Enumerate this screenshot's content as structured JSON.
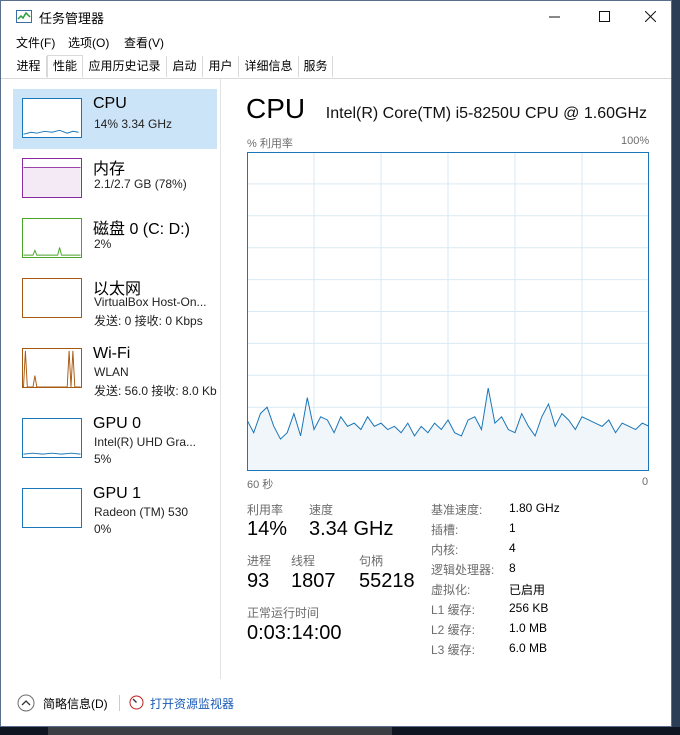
{
  "window": {
    "title": "任务管理器"
  },
  "menu": [
    "文件(F)",
    "选项(O)",
    "查看(V)"
  ],
  "tabs": [
    "进程",
    "性能",
    "应用历史记录",
    "启动",
    "用户",
    "详细信息",
    "服务"
  ],
  "active_tab": "性能",
  "resources": [
    {
      "name": "CPU",
      "line1": "14% 3.34 GHz",
      "line2": "",
      "color": "#1a76b8"
    },
    {
      "name": "内存",
      "line1": "2.1/2.7 GB (78%)",
      "line2": "",
      "color": "#8b2a9e"
    },
    {
      "name": "磁盘 0 (C: D:)",
      "line1": "2%",
      "line2": "",
      "color": "#4aa42a"
    },
    {
      "name": "以太网",
      "line1": "VirtualBox Host-On...",
      "line2": "发送: 0 接收: 0 Kbps",
      "color": "#a75a12"
    },
    {
      "name": "Wi-Fi",
      "line1": "WLAN",
      "line2": "发送: 56.0 接收: 8.0 Kb",
      "color": "#a75a12"
    },
    {
      "name": "GPU 0",
      "line1": "Intel(R) UHD Gra...",
      "line2": "5%",
      "color": "#1a76b8"
    },
    {
      "name": "GPU 1",
      "line1": "Radeon (TM) 530",
      "line2": "0%",
      "color": "#1a76b8"
    }
  ],
  "main": {
    "title": "CPU",
    "model": "Intel(R) Core(TM) i5-8250U CPU @ 1.60GHz",
    "y_label": "% 利用率",
    "y_max_label": "100%",
    "x_left_label": "60 秒",
    "x_right_label": "0"
  },
  "chart_data": {
    "type": "area",
    "ylim": [
      0,
      100
    ],
    "x": [
      60,
      59,
      58,
      57,
      56,
      55,
      54,
      53,
      52,
      51,
      50,
      49,
      48,
      47,
      46,
      45,
      44,
      43,
      42,
      41,
      40,
      39,
      38,
      37,
      36,
      35,
      34,
      33,
      32,
      31,
      30,
      29,
      28,
      27,
      26,
      25,
      24,
      23,
      22,
      21,
      20,
      19,
      18,
      17,
      16,
      15,
      14,
      13,
      12,
      11,
      10,
      9,
      8,
      7,
      6,
      5,
      4,
      3,
      2,
      1,
      0
    ],
    "values": [
      16,
      12,
      18,
      20,
      14,
      10,
      12,
      18,
      11,
      23,
      13,
      17,
      16,
      12,
      17,
      14,
      15,
      13,
      17,
      14,
      15,
      13,
      14,
      12,
      15,
      11,
      14,
      12,
      15,
      13,
      16,
      12,
      11,
      16,
      17,
      13,
      26,
      15,
      17,
      13,
      12,
      18,
      14,
      11,
      17,
      21,
      14,
      18,
      16,
      13,
      17,
      16,
      15,
      14,
      16,
      12,
      15,
      14,
      13,
      15,
      14
    ]
  },
  "stats": {
    "utilization_label": "利用率",
    "utilization_value": "14%",
    "speed_label": "速度",
    "speed_value": "3.34 GHz",
    "processes_label": "进程",
    "processes_value": "93",
    "threads_label": "线程",
    "threads_value": "1807",
    "handles_label": "句柄",
    "handles_value": "55218",
    "uptime_label": "正常运行时间",
    "uptime_value": "0:03:14:00"
  },
  "specs": [
    {
      "label": "基准速度:",
      "value": "1.80 GHz"
    },
    {
      "label": "插槽:",
      "value": "1"
    },
    {
      "label": "内核:",
      "value": "4"
    },
    {
      "label": "逻辑处理器:",
      "value": "8"
    },
    {
      "label": "虚拟化:",
      "value": "已启用"
    },
    {
      "label": "L1 缓存:",
      "value": "256 KB"
    },
    {
      "label": "L2 缓存:",
      "value": "1.0 MB"
    },
    {
      "label": "L3 缓存:",
      "value": "6.0 MB"
    }
  ],
  "footer": {
    "fewer_details": "简略信息(D)",
    "resource_monitor": "打开资源监视器"
  },
  "colors": {
    "accent": "#1a76b8",
    "graph_fill": "#f1f6fa",
    "grid": "#d9eaf4",
    "selected_bg": "#cce4f7"
  }
}
